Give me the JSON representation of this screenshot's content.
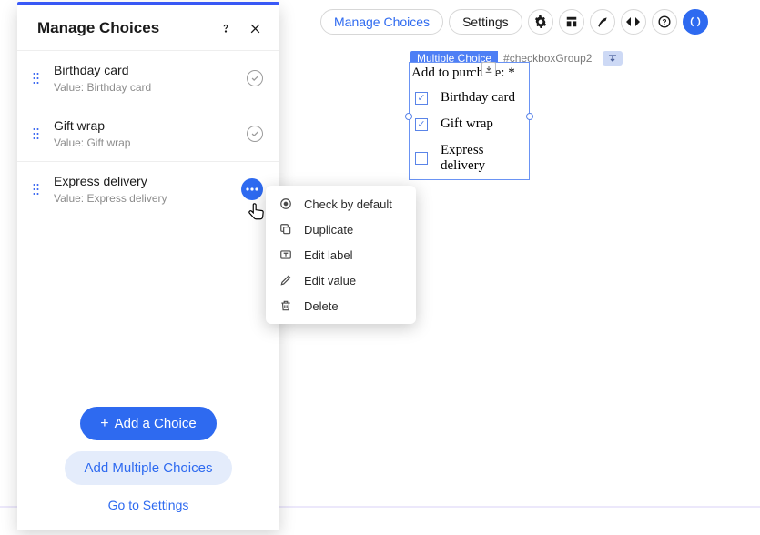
{
  "panel": {
    "title": "Manage Choices",
    "add_choice_label": "Add a Choice",
    "add_multiple_label": "Add Multiple Choices",
    "go_to_settings_label": "Go to Settings",
    "choices": [
      {
        "label": "Birthday card",
        "value_line": "Value: Birthday card",
        "checked_default": true
      },
      {
        "label": "Gift wrap",
        "value_line": "Value: Gift wrap",
        "checked_default": true
      },
      {
        "label": "Express delivery",
        "value_line": "Value: Express delivery",
        "checked_default": false
      }
    ]
  },
  "context_menu": {
    "items": [
      {
        "label": "Check by default",
        "icon": "radio-check-icon"
      },
      {
        "label": "Duplicate",
        "icon": "duplicate-icon"
      },
      {
        "label": "Edit label",
        "icon": "text-icon"
      },
      {
        "label": "Edit value",
        "icon": "pencil-icon"
      },
      {
        "label": "Delete",
        "icon": "trash-icon"
      }
    ]
  },
  "toolbar": {
    "manage_label": "Manage Choices",
    "settings_label": "Settings"
  },
  "canvas": {
    "element_type": "Multiple Choice",
    "element_id": "#checkboxGroup2",
    "group_title": "Add to purchase: *",
    "options": [
      {
        "label": "Birthday card",
        "checked": true
      },
      {
        "label": "Gift wrap",
        "checked": true
      },
      {
        "label": "Express delivery",
        "checked": false
      }
    ]
  }
}
